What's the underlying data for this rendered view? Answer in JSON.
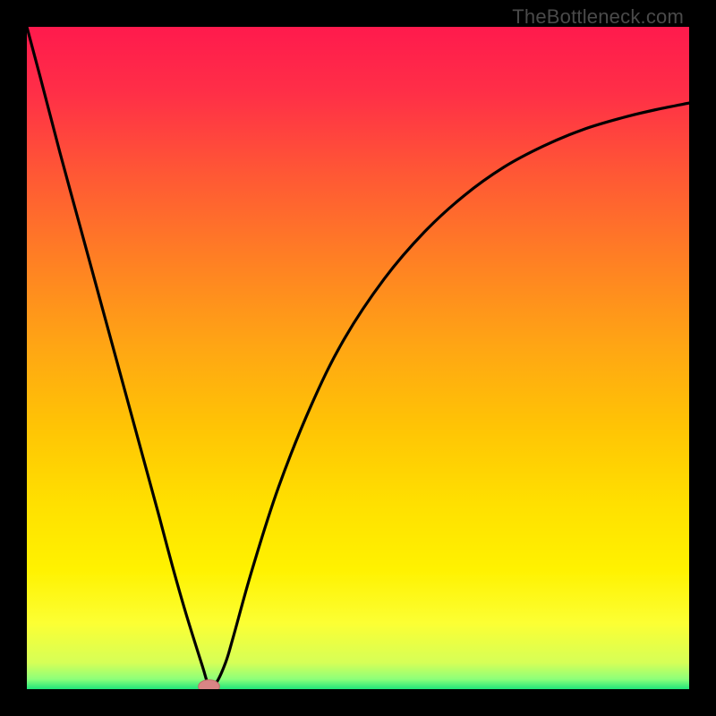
{
  "watermark": "TheBottleneck.com",
  "colors": {
    "frame": "#000000",
    "curve": "#000000",
    "marker_fill": "#d98585",
    "marker_stroke": "#c46a6a",
    "gradient_stops": [
      {
        "pos": 0.0,
        "hex": "#ff1a4d"
      },
      {
        "pos": 0.1,
        "hex": "#ff2f47"
      },
      {
        "pos": 0.22,
        "hex": "#ff5735"
      },
      {
        "pos": 0.35,
        "hex": "#ff7f24"
      },
      {
        "pos": 0.48,
        "hex": "#ffa514"
      },
      {
        "pos": 0.6,
        "hex": "#ffc305"
      },
      {
        "pos": 0.72,
        "hex": "#ffe000"
      },
      {
        "pos": 0.82,
        "hex": "#fff200"
      },
      {
        "pos": 0.9,
        "hex": "#fcff33"
      },
      {
        "pos": 0.96,
        "hex": "#d6ff57"
      },
      {
        "pos": 0.985,
        "hex": "#8cff7a"
      },
      {
        "pos": 1.0,
        "hex": "#1fe47a"
      }
    ]
  },
  "chart_data": {
    "type": "line",
    "title": "",
    "xlabel": "",
    "ylabel": "",
    "xlim": [
      0,
      100
    ],
    "ylim": [
      0,
      100
    ],
    "grid": false,
    "legend": false,
    "note": "Bottleneck-style chart: background color encodes bottleneck severity from red (high) at top to green (minimal) at bottom; black curve shows bottleneck percentage; pink marker marks the minimum (optimal balance).",
    "series": [
      {
        "name": "bottleneck_curve",
        "x": [
          0.0,
          2.0,
          5.0,
          8.0,
          11.0,
          14.0,
          17.0,
          20.0,
          22.0,
          24.0,
          26.5,
          27.5,
          28.5,
          30.0,
          31.2,
          34.0,
          38.0,
          43.0,
          48.0,
          54.0,
          60.0,
          66.0,
          72.0,
          78.0,
          84.0,
          90.0,
          95.0,
          100.0
        ],
        "y": [
          100.0,
          92.5,
          81.0,
          70.0,
          59.0,
          48.0,
          37.0,
          26.0,
          18.5,
          11.5,
          3.5,
          0.5,
          0.8,
          4.0,
          8.0,
          18.0,
          30.5,
          43.0,
          53.0,
          62.0,
          69.0,
          74.5,
          78.8,
          82.0,
          84.5,
          86.3,
          87.5,
          88.5
        ]
      }
    ],
    "marker": {
      "x": 27.5,
      "y": 0.4,
      "rx": 1.6,
      "ry": 1.0
    }
  }
}
